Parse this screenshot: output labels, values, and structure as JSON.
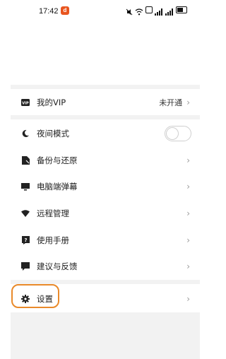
{
  "status_bar": {
    "time": "17:42",
    "app_badge": "d"
  },
  "menu": {
    "vip": {
      "label": "我的VIP",
      "value": "未开通"
    },
    "night_mode": {
      "label": "夜间模式",
      "enabled": false
    },
    "items": [
      {
        "label": "备份与还原"
      },
      {
        "label": "电脑端弹幕"
      },
      {
        "label": "远程管理"
      },
      {
        "label": "使用手册"
      },
      {
        "label": "建议与反馈"
      }
    ],
    "settings": {
      "label": "设置"
    }
  },
  "icons": {
    "vip": "vip-icon",
    "night": "moon-icon",
    "backup": "backup-icon",
    "pc": "monitor-icon",
    "remote": "wifi-icon",
    "manual": "help-icon",
    "feedback": "chat-icon",
    "settings": "gear-icon",
    "chevron": "chevron-right-icon"
  },
  "colors": {
    "highlight": "#e98a2a",
    "section_gap": "#f2f2f2"
  }
}
